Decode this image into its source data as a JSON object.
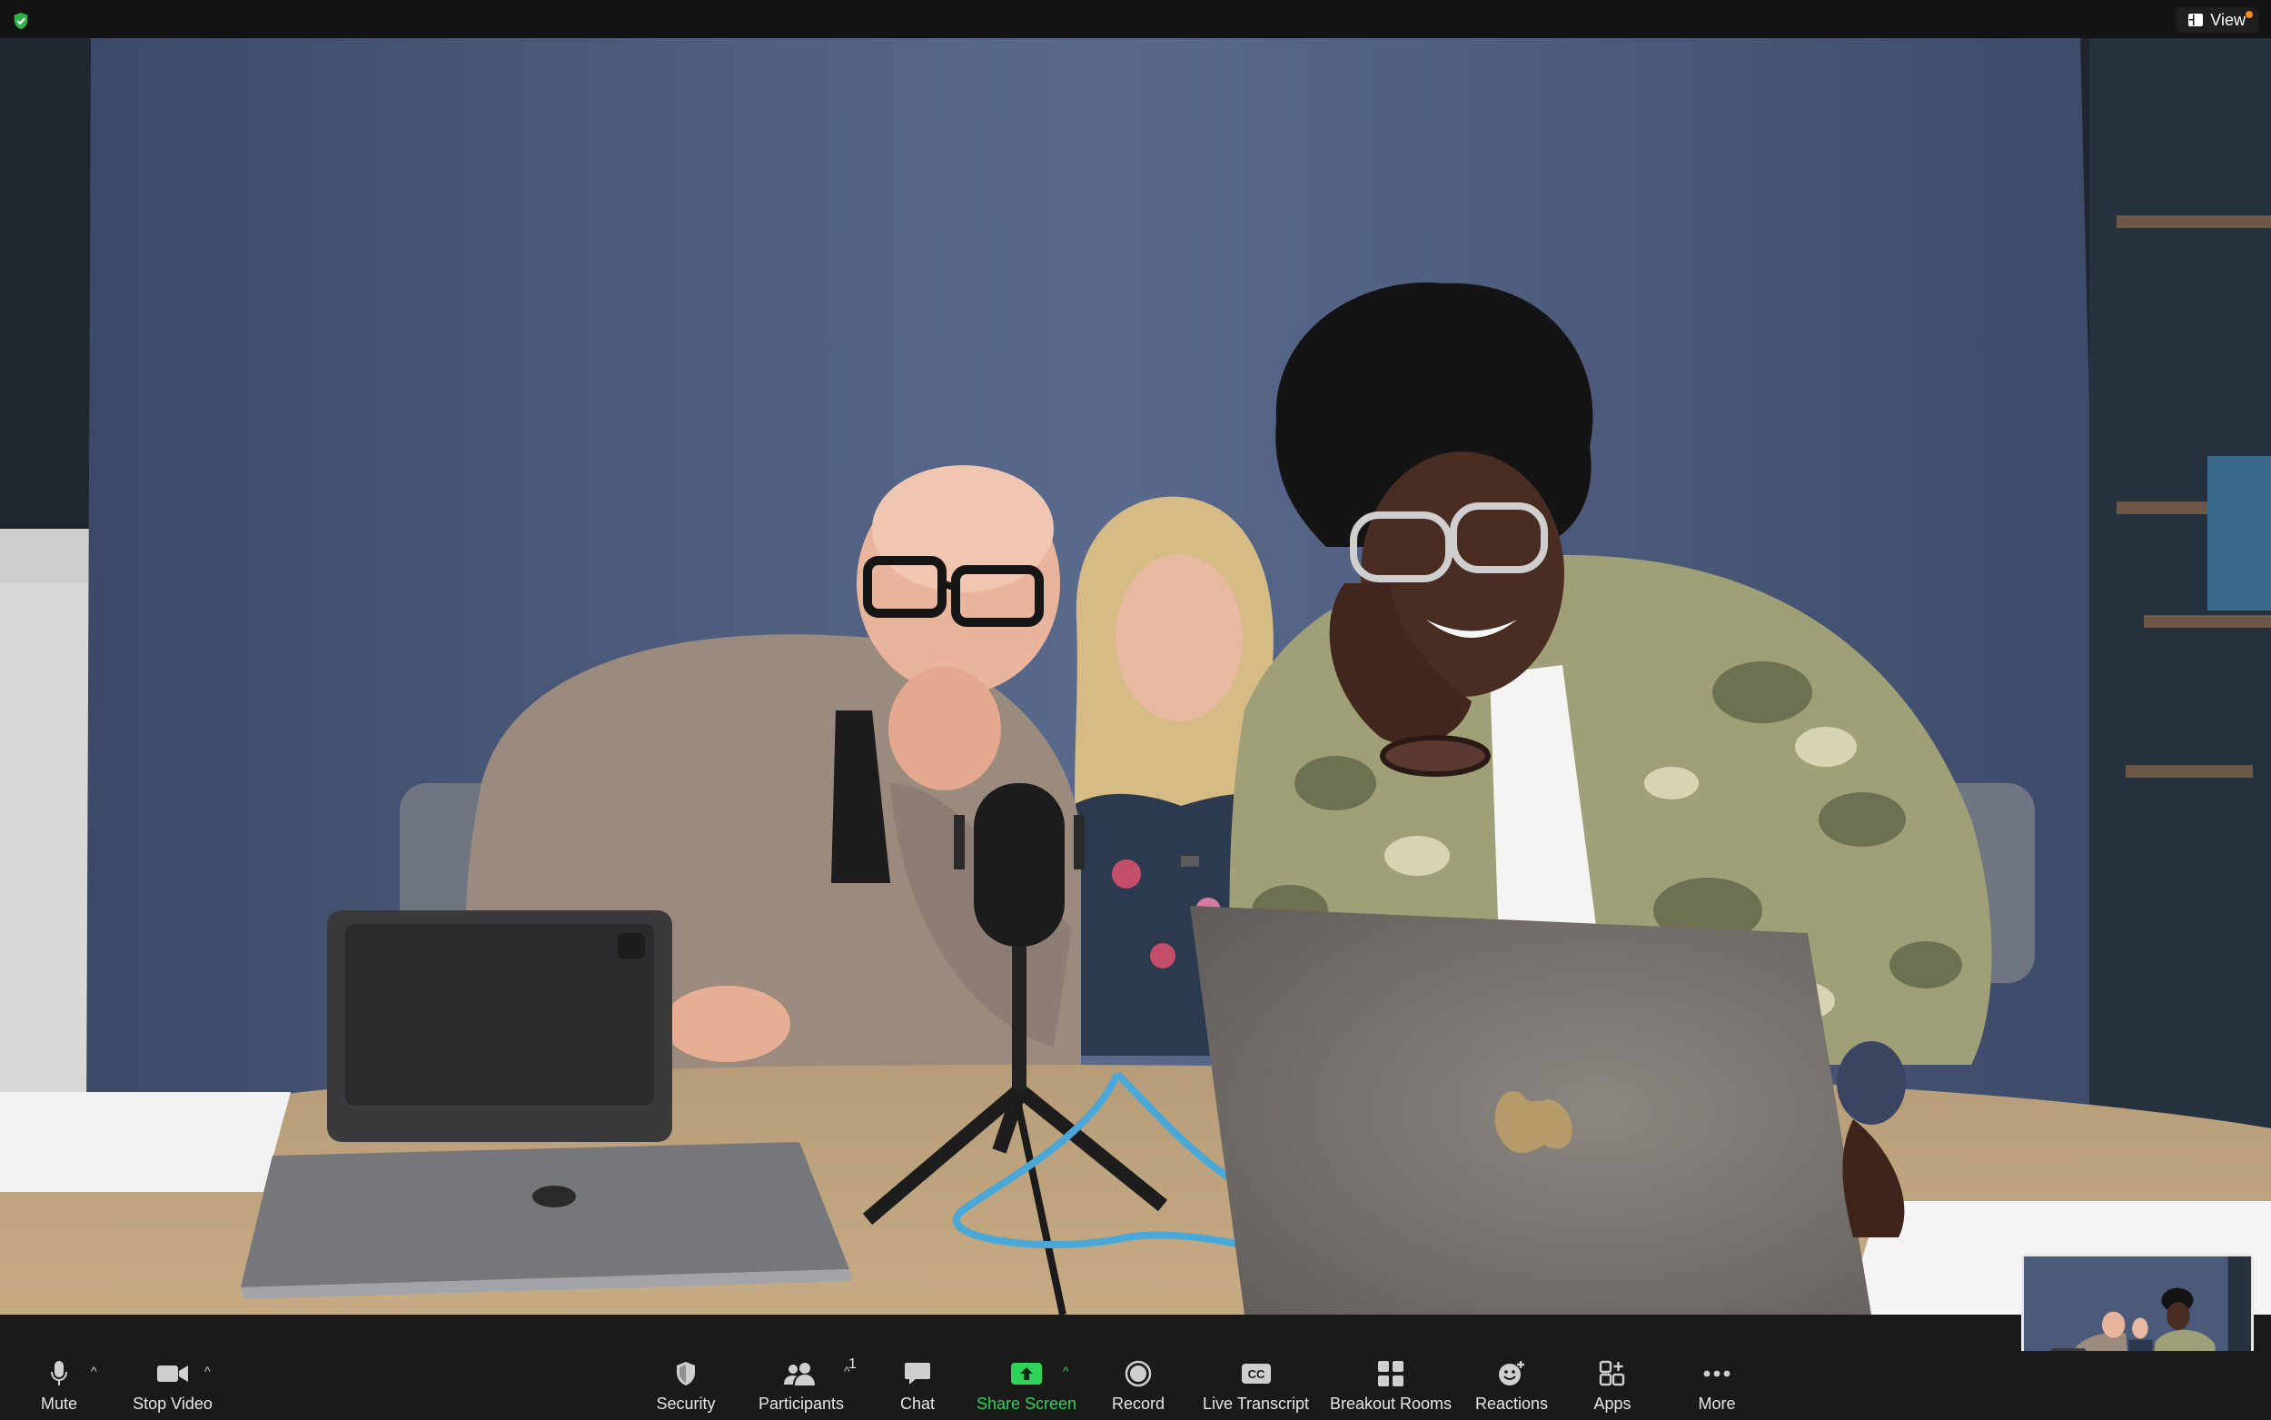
{
  "topbar": {
    "view_label": "View"
  },
  "toolbar": {
    "mute_label": "Mute",
    "stop_video_label": "Stop Video",
    "security_label": "Security",
    "participants_label": "Participants",
    "participants_count": "1",
    "chat_label": "Chat",
    "share_screen_label": "Share Screen",
    "record_label": "Record",
    "live_transcript_label": "Live Transcript",
    "breakout_rooms_label": "Breakout Rooms",
    "reactions_label": "Reactions",
    "apps_label": "Apps",
    "more_label": "More"
  },
  "icons": {
    "encryption": "shield-check-icon",
    "view": "grid-view-icon",
    "mute": "microphone-icon",
    "video": "video-camera-icon",
    "security": "shield-icon",
    "participants": "people-icon",
    "chat": "speech-bubble-icon",
    "share": "share-arrow-icon",
    "record": "record-circle-icon",
    "transcript": "cc-icon",
    "breakout": "four-squares-icon",
    "reactions": "smiley-plus-icon",
    "apps": "apps-icon",
    "more": "ellipsis-icon"
  },
  "colors": {
    "share_green": "#2fd35a",
    "encryption_green": "#2fb34a",
    "notification_orange": "#f58a1f",
    "toolbar_bg": "#1a1a1a"
  }
}
